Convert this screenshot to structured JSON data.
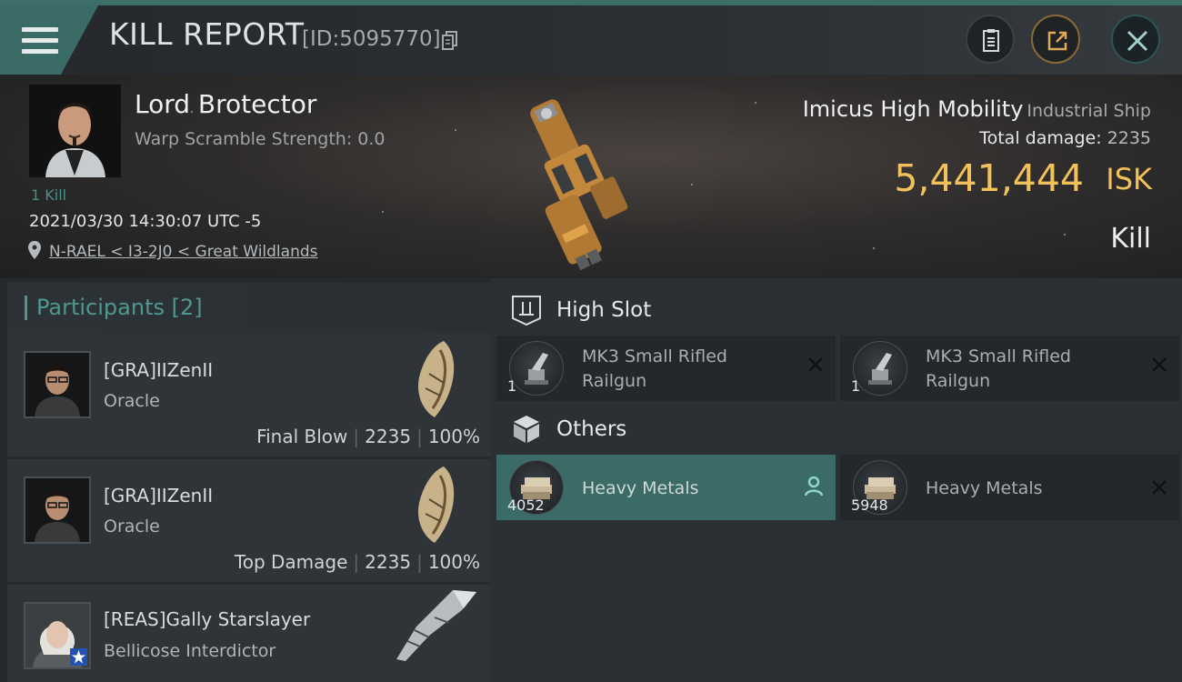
{
  "header": {
    "title": "KILL REPORT",
    "report_id": "[ID:5095770]"
  },
  "victim": {
    "name": "Lord Brotector",
    "warp_scramble": "Warp Scramble Strength: 0.0",
    "kills": "1 Kill",
    "timestamp": "2021/03/30 14:30:07 UTC -5",
    "location": "N-RAEL < I3-2J0 < Great Wildlands"
  },
  "ship": {
    "name": "Imicus High Mobility",
    "class": "Industrial Ship",
    "total_damage_label": "Total damage:",
    "total_damage": "2235",
    "isk_value": "5,441,444",
    "isk_unit": "ISK",
    "report_type": "Kill"
  },
  "participants": {
    "title": "Participants",
    "count": "[2]",
    "list": [
      {
        "name": "[GRA]IIZenII",
        "ship": "Oracle",
        "tag": "Final Blow",
        "damage": "2235",
        "percent": "100%"
      },
      {
        "name": "[GRA]IIZenII",
        "ship": "Oracle",
        "tag": "Top Damage",
        "damage": "2235",
        "percent": "100%"
      },
      {
        "name": "[REAS]Gally Starslayer",
        "ship": "Bellicose Interdictor",
        "tag": "",
        "damage": "",
        "percent": ""
      }
    ]
  },
  "sections": {
    "high_slot": {
      "label": "High Slot",
      "items": [
        {
          "line1": "MK3 Small Rifled",
          "line2": "Railgun",
          "qty": "1",
          "state": "destroyed"
        },
        {
          "line1": "MK3 Small Rifled",
          "line2": "Railgun",
          "qty": "1",
          "state": "destroyed"
        }
      ]
    },
    "others": {
      "label": "Others",
      "items": [
        {
          "line1": "Heavy Metals",
          "qty": "4052",
          "state": "dropped"
        },
        {
          "line1": "Heavy Metals",
          "qty": "5948",
          "state": "destroyed"
        }
      ]
    }
  },
  "colors": {
    "accent_teal": "#3d6e6a",
    "isk_gold": "#f2c15a",
    "selected_slot": "#3b6b67"
  },
  "icons": {
    "menu": "menu-icon",
    "copy": "copy-icon",
    "clipboard": "clipboard-icon",
    "share": "share-icon",
    "close": "close-icon",
    "location": "location-pin-icon",
    "high_slot": "high-slot-icon",
    "others": "cargo-box-icon",
    "destroyed": "x-icon",
    "dropped": "person-icon"
  }
}
